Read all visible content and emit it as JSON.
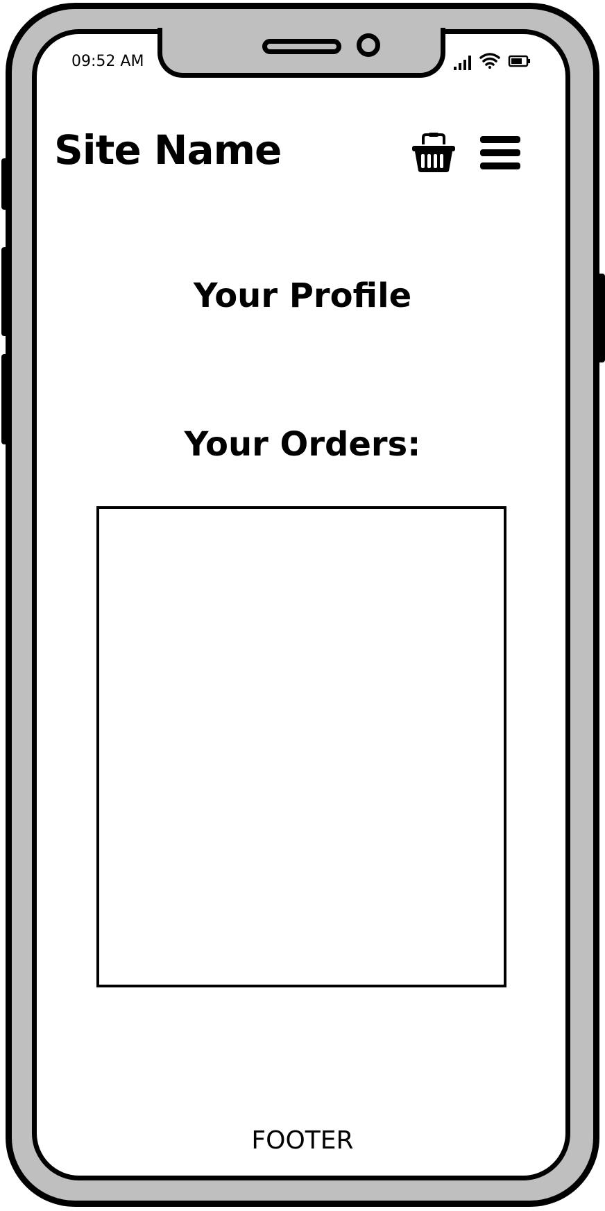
{
  "status_bar": {
    "time": "09:52 AM",
    "icons": [
      "signal-icon",
      "wifi-icon",
      "battery-icon"
    ]
  },
  "header": {
    "site_name": "Site Name",
    "icons": [
      "basket-icon",
      "menu-icon"
    ]
  },
  "main": {
    "profile_title": "Your Profile",
    "orders_title": "Your Orders:"
  },
  "footer": {
    "label": "FOOTER"
  },
  "colors": {
    "frame": "#bfbfbf",
    "outline": "#000000",
    "screen": "#ffffff"
  }
}
